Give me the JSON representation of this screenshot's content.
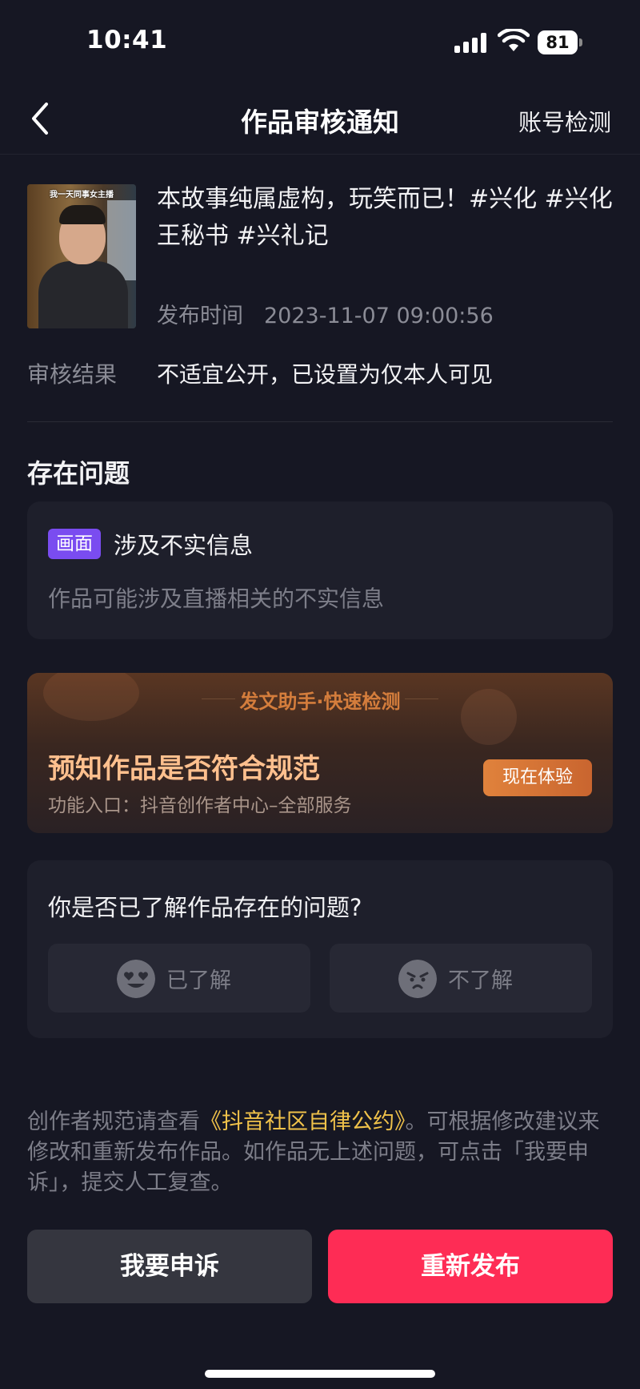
{
  "status_bar": {
    "time": "10:41",
    "battery": "81",
    "icons": [
      "signal-icon",
      "wifi-icon",
      "battery-icon"
    ]
  },
  "nav": {
    "back_icon": "chevron-left-icon",
    "title": "作品审核通知",
    "right_label": "账号检测"
  },
  "video": {
    "thumbnail_caption": "我一天同事女主播",
    "title": "本故事纯属虚构，玩笑而已！#兴化 #兴化王秘书 #兴礼记",
    "publish_label": "发布时间",
    "publish_time": "2023-11-07 09:00:56"
  },
  "review": {
    "label": "审核结果",
    "value": "不适宜公开，已设置为仅本人可见"
  },
  "issues": {
    "heading": "存在问题",
    "items": [
      {
        "tag": "画面",
        "title": "涉及不实信息",
        "description": "作品可能涉及直播相关的不实信息"
      }
    ]
  },
  "assistant": {
    "header": "发文助手·快速检测",
    "title": "预知作品是否符合规范",
    "subtitle": "功能入口：抖音创作者中心–全部服务",
    "button": "现在体验"
  },
  "feedback": {
    "question": "你是否已了解作品存在的问题?",
    "options": [
      {
        "label": "已了解",
        "icon": "heart-eyes-face-icon"
      },
      {
        "label": "不了解",
        "icon": "angry-face-icon"
      }
    ]
  },
  "footer": {
    "note_before": "创作者规范请查看",
    "note_link": "《抖音社区自律公约》",
    "note_after": "。可根据修改建议来修改和重新发布作品。如作品无上述问题，可点击「我要申诉」，提交人工复查。"
  },
  "actions": {
    "appeal": "我要申诉",
    "republish": "重新发布"
  },
  "colors": {
    "background": "#161723",
    "card": "#1e1f2b",
    "primary": "#fe2c55",
    "tag": "#7a4cf0",
    "link": "#f0c24a",
    "assistant_accent": "#ffc08e"
  }
}
